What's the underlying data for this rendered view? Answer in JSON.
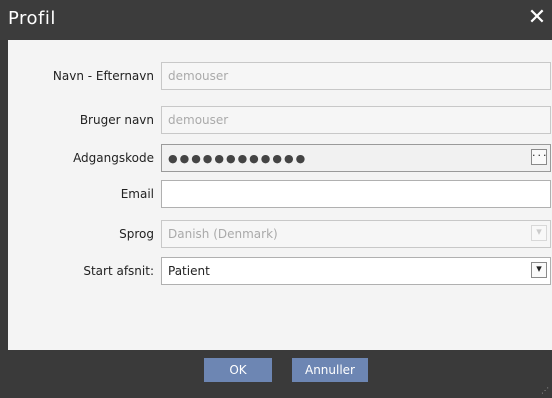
{
  "dialog": {
    "title": "Profil",
    "close_icon": "close-icon",
    "fields": [
      {
        "label": "Navn - Efternavn",
        "value": "demouser"
      },
      {
        "label": "Bruger navn",
        "value": "demouser"
      },
      {
        "label": "Adgangskode",
        "value": "●●●●●●●●●●●●",
        "button_label": "···"
      },
      {
        "label": "Email",
        "value": ""
      },
      {
        "label": "Sprog",
        "value": "Danish (Denmark)"
      },
      {
        "label": "Start afsnit:",
        "value": "Patient"
      }
    ],
    "ok_label": "OK",
    "cancel_label": "Annuller",
    "colors": {
      "titlebar": "#3c3c3c",
      "button": "#6d86b3",
      "content": "#f4f4f4"
    }
  }
}
